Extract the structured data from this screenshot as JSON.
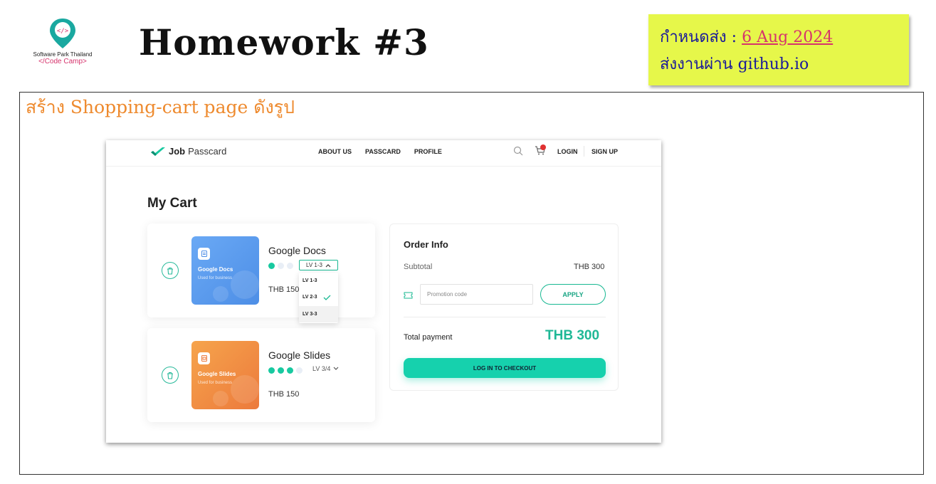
{
  "slide": {
    "logo": {
      "line1": "Software Park Thailand",
      "line2": "</Code Camp>",
      "icon": "code-pin-icon"
    },
    "title": "Homework #3",
    "note": {
      "due_label": "กำหนดส่ง : ",
      "due_date": "6 Aug 2024",
      "submit_text": "ส่งงานผ่าน github.io"
    },
    "instruction": "สร้าง Shopping-cart page ดังรูป"
  },
  "nav": {
    "brand_bold": "Job",
    "brand_rest": "Passcard",
    "links": [
      "ABOUT US",
      "PASSCARD",
      "PROFILE"
    ],
    "login": "LOGIN",
    "signup": "SIGN UP",
    "icons": [
      "search-icon",
      "cart-icon"
    ]
  },
  "cart": {
    "title": "My Cart",
    "items": [
      {
        "name": "Google Docs",
        "thumb_title": "Google Docs",
        "thumb_sub": "Used for business",
        "level": "LV 1-3",
        "level_dots_filled": 1,
        "level_dots_total": 3,
        "price": "THB 150",
        "color": "#5a9cf0"
      },
      {
        "name": "Google Slides",
        "thumb_title": "Google Slides",
        "thumb_sub": "Used for business",
        "level": "LV 3/4",
        "level_dots_filled": 3,
        "level_dots_total": 4,
        "price": "THB 150",
        "color": "#f08a42"
      }
    ],
    "dropdown_options": [
      "LV 1-3",
      "LV 2-3",
      "LV 3-3"
    ],
    "dropdown_checked": "LV 2-3"
  },
  "order": {
    "title": "Order Info",
    "subtotal_label": "Subtotal",
    "subtotal_value": "THB 300",
    "promo_placeholder": "Promotion code",
    "apply_label": "APPLY",
    "total_label": "Total payment",
    "total_value": "THB 300",
    "checkout_label": "LOG IN TO CHECKOUT"
  },
  "colors": {
    "accent": "#16d1ad",
    "note_bg": "#e6f74a",
    "instruction": "#ee8a2e",
    "due_date": "#d6336c"
  }
}
